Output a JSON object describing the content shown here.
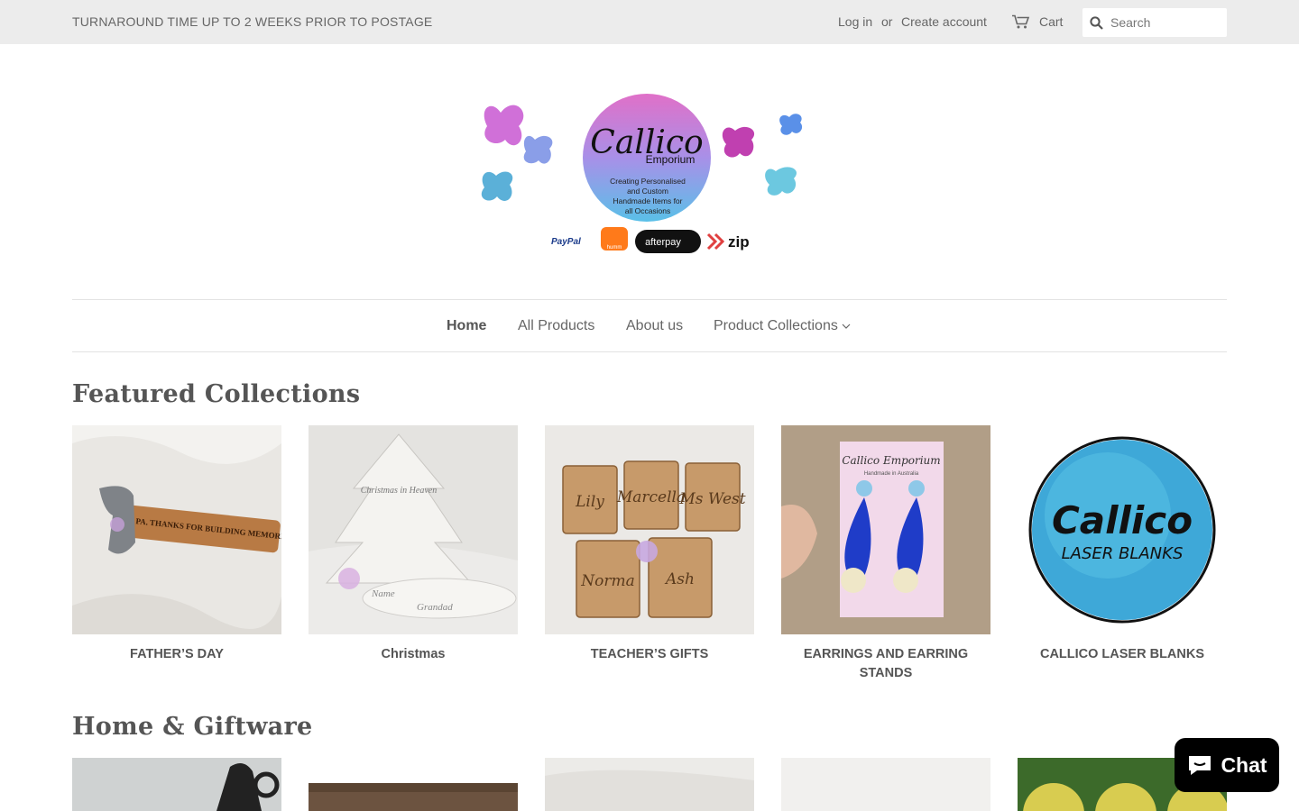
{
  "topbar": {
    "announcement": "TURNAROUND TIME UP TO 2 WEEKS PRIOR TO POSTAGE",
    "login": "Log in",
    "or": "or",
    "create_account": "Create account",
    "cart": "Cart",
    "search_placeholder": "Search"
  },
  "logo": {
    "brand": "Callico",
    "sub": "Emporium",
    "tagline": [
      "Creating Personalised",
      "and Custom",
      "Handmade Items for",
      "all Occasions"
    ],
    "payments": [
      "PayPal",
      "humm",
      "afterpay",
      "zip"
    ]
  },
  "nav": {
    "items": [
      "Home",
      "All Products",
      "About us",
      "Product Collections"
    ],
    "active": "Home"
  },
  "sections": {
    "featured": "Featured Collections",
    "home_giftware": "Home & Giftware"
  },
  "collections": [
    {
      "label": "FATHER’S DAY",
      "engraving": "PA. THANKS FOR BUILDING MEMORIES WITH US"
    },
    {
      "label": "Christmas",
      "engraving": [
        "Christmas in Heaven",
        "Name",
        "Grandad"
      ]
    },
    {
      "label": "TEACHER’S GIFTS",
      "engraving": [
        "Lily",
        "Marcella",
        "Ms West",
        "Norma",
        "Ash"
      ]
    },
    {
      "label": "EARRINGS AND EARRING STANDS",
      "card_text": "Callico Emporium",
      "card_sub": "Handmade in Australia"
    },
    {
      "label": "CALLICO LASER BLANKS",
      "logo_main": "Callico",
      "logo_sub": "LASER BLANKS"
    }
  ],
  "chat": {
    "label": "Chat"
  },
  "colors": {
    "topbar": "#ececec",
    "chat_bg": "#000000",
    "wood": "#c79a6a"
  }
}
